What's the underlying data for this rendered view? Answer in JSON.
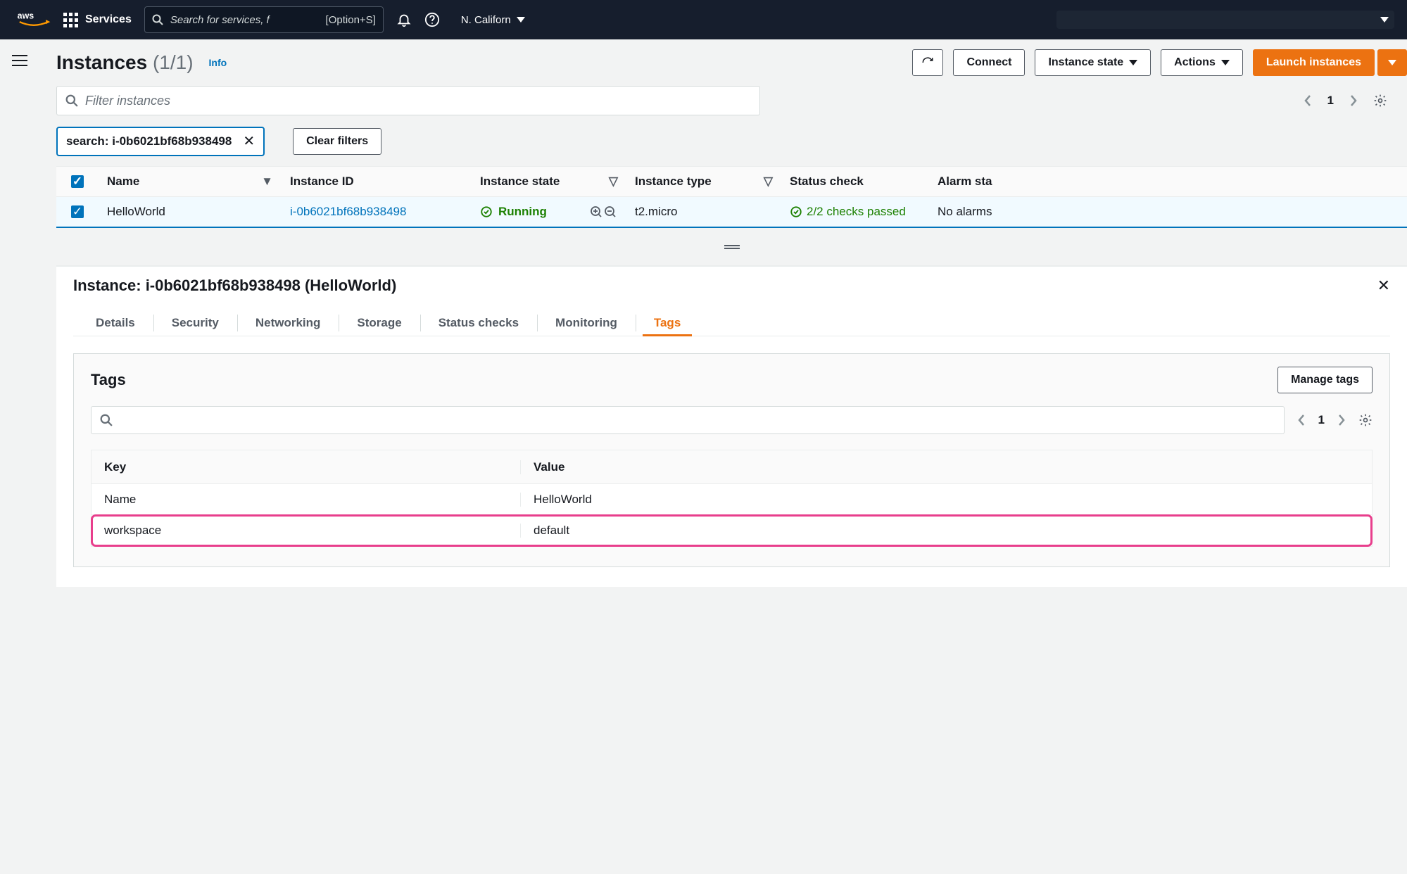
{
  "nav": {
    "services_label": "Services",
    "search_placeholder": "Search for services, f",
    "search_shortcut": "[Option+S]",
    "region": "N. Californ"
  },
  "toolbar": {
    "title": "Instances",
    "count": "(1/1)",
    "info": "Info",
    "connect": "Connect",
    "instance_state": "Instance state",
    "actions": "Actions",
    "launch": "Launch instances"
  },
  "filter": {
    "placeholder": "Filter instances",
    "page": "1"
  },
  "chip": {
    "label": "search:",
    "value": "i-0b6021bf68b938498"
  },
  "clear_filters": "Clear filters",
  "columns": {
    "name": "Name",
    "id": "Instance ID",
    "state": "Instance state",
    "type": "Instance type",
    "status": "Status check",
    "alarm": "Alarm sta"
  },
  "row": {
    "name": "HelloWorld",
    "id": "i-0b6021bf68b938498",
    "state": "Running",
    "type": "t2.micro",
    "status": "2/2 checks passed",
    "alarm": "No alarms"
  },
  "detail": {
    "title": "Instance: i-0b6021bf68b938498 (HelloWorld)",
    "tabs": [
      "Details",
      "Security",
      "Networking",
      "Storage",
      "Status checks",
      "Monitoring",
      "Tags"
    ],
    "active_tab": 6,
    "tags_panel": {
      "title": "Tags",
      "manage": "Manage tags",
      "page": "1",
      "cols": {
        "key": "Key",
        "value": "Value"
      },
      "rows": [
        {
          "key": "Name",
          "value": "HelloWorld",
          "hl": false
        },
        {
          "key": "workspace",
          "value": "default",
          "hl": true
        }
      ]
    }
  }
}
